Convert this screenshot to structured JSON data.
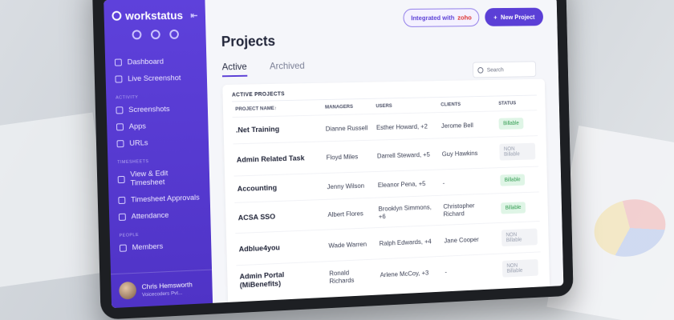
{
  "app": {
    "brand": "workstatus"
  },
  "sidebar": {
    "items": [
      {
        "label": "Dashboard",
        "icon": "dashboard-icon"
      },
      {
        "label": "Live Screenshot",
        "icon": "screenshot-icon"
      }
    ],
    "sections": [
      {
        "title": "ACTIVITY",
        "items": [
          {
            "label": "Screenshots",
            "icon": "screenshots-icon"
          },
          {
            "label": "Apps",
            "icon": "apps-icon"
          },
          {
            "label": "URLs",
            "icon": "urls-icon"
          }
        ]
      },
      {
        "title": "TIMESHEETS",
        "items": [
          {
            "label": "View & Edit Timesheet",
            "icon": "timesheet-icon"
          },
          {
            "label": "Timesheet Approvals",
            "icon": "approvals-icon"
          },
          {
            "label": "Attendance",
            "icon": "attendance-icon"
          }
        ]
      },
      {
        "title": "PEOPLE",
        "items": [
          {
            "label": "Members",
            "icon": "members-icon"
          }
        ]
      }
    ],
    "user": {
      "name": "Chris Hemsworth",
      "company": "Voicecoders Pvt..."
    }
  },
  "header": {
    "integrated_prefix": "Integrated with",
    "integrated_brand": "zoho",
    "new_project": "New Project"
  },
  "main": {
    "title": "Projects",
    "tabs": [
      "Active",
      "Archived"
    ],
    "search_placeholder": "Search",
    "table_title": "ACTIVE PROJECTS",
    "columns": [
      "PROJECT NAME↑",
      "MANAGERS",
      "USERS",
      "CLIENTS",
      "STATUS"
    ],
    "rows": [
      {
        "project": ".Net Training",
        "manager": "Dianne Russell",
        "users": "Esther Howard, +2",
        "client": "Jerome Bell",
        "status": "Billable"
      },
      {
        "project": "Admin Related Task",
        "manager": "Floyd Miles",
        "users": "Darrell Steward, +5",
        "client": "Guy Hawkins",
        "status": "NON Billable"
      },
      {
        "project": "Accounting",
        "manager": "Jenny Wilson",
        "users": "Eleanor Pena, +5",
        "client": "-",
        "status": "Billable"
      },
      {
        "project": "ACSA SSO",
        "manager": "Albert Flores",
        "users": "Brooklyn Simmons, +6",
        "client": "Christopher Richard",
        "status": "Billable"
      },
      {
        "project": "Adblue4you",
        "manager": "Wade Warren",
        "users": "Ralph Edwards, +4",
        "client": "Jane Cooper",
        "status": "NON Billable"
      },
      {
        "project": "Admin Portal (MiBenefits)",
        "manager": "Ronald Richards",
        "users": "Arlene McCoy, +3",
        "client": "-",
        "status": "NON Billable"
      }
    ]
  }
}
